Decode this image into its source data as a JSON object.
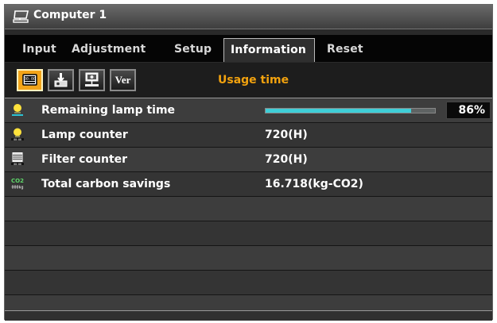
{
  "window": {
    "title": "Computer 1",
    "title_icon": "computer-monitor-icon"
  },
  "menu": {
    "tabs": [
      {
        "label": "Input"
      },
      {
        "label": "Adjustment"
      },
      {
        "label": "Setup"
      },
      {
        "label": "Information",
        "active": true
      },
      {
        "label": "Reset"
      }
    ]
  },
  "subtabs": {
    "icons": [
      "usage-time-icon",
      "projector-icon",
      "network-icon",
      "version-icon"
    ],
    "ver_label": "Ver",
    "active_label": "Usage time",
    "active_color": "#f2a20e"
  },
  "info": {
    "rows": [
      {
        "label": "Remaining lamp time",
        "value": "86%",
        "progress": 0.86,
        "icon": "lamp-icon"
      },
      {
        "label": "Lamp counter",
        "value": "720(H)",
        "icon": "lamp-counter-icon"
      },
      {
        "label": "Filter counter",
        "value": "720(H)",
        "icon": "filter-counter-icon"
      },
      {
        "label": "Total carbon savings",
        "value": "16.718(kg-CO2)",
        "icon": "co2-icon"
      }
    ]
  },
  "colors": {
    "progress_fill": "#3fcfd8",
    "active_subtab": "#f2a41a"
  }
}
